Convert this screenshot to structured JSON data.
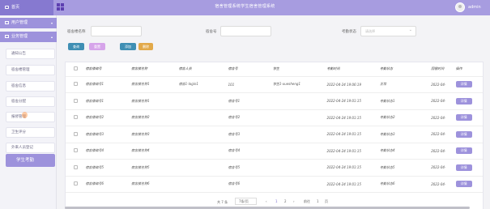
{
  "header": {
    "brand": "首页",
    "title": "宿舍管理系统学生宿舍管理系统",
    "user": "admin"
  },
  "sidebar": {
    "groups": [
      {
        "label": "用户管理"
      },
      {
        "label": "业务管理"
      }
    ],
    "items": [
      {
        "label": "通知公告"
      },
      {
        "label": "宿舍楼管理"
      },
      {
        "label": "宿舍信息"
      },
      {
        "label": "宿舍分配"
      },
      {
        "label": "报修管理"
      },
      {
        "label": "卫生评分"
      },
      {
        "label": "外来人员登记"
      },
      {
        "label": "学生考勤"
      }
    ],
    "active_index": 7
  },
  "search": {
    "building_label": "宿舍楼名称",
    "room_label": "宿舍号",
    "status_label": "考勤状态",
    "status_placeholder": "请选择"
  },
  "buttons": {
    "query": "查询",
    "reset": "重置",
    "add": "添加",
    "delete": "删除"
  },
  "table": {
    "columns": [
      "",
      "宿舍楼编号",
      "宿舍楼名称",
      "宿舍人员",
      "宿舍号",
      "学生",
      "考勤时间",
      "考勤状态",
      "回寝时间",
      "操作"
    ],
    "rows": [
      [
        "宿舍楼编号1",
        "宿舍楼名称1",
        "宿舍1-login1",
        "101",
        "学生1-xuesheng1",
        "2022-04-24 19:06:19",
        "正常",
        "2022-04-",
        "详情"
      ],
      [
        "宿舍楼编号1",
        "宿舍楼名称1",
        "",
        "宿舍号1",
        "",
        "2022-04-24 19:01:15",
        "考勤状态1",
        "2022-04-",
        "详情"
      ],
      [
        "宿舍楼编号2",
        "宿舍楼名称2",
        "",
        "宿舍号2",
        "",
        "2022-04-24 19:01:15",
        "考勤状态2",
        "2022-04-",
        "详情"
      ],
      [
        "宿舍楼编号3",
        "宿舍楼名称3",
        "",
        "宿舍号3",
        "",
        "2022-04-24 19:01:15",
        "考勤状态3",
        "2022-04-",
        "详情"
      ],
      [
        "宿舍楼编号4",
        "宿舍楼名称4",
        "",
        "宿舍号4",
        "",
        "2022-04-24 19:01:15",
        "考勤状态4",
        "2022-04-",
        "详情"
      ],
      [
        "宿舍楼编号5",
        "宿舍楼名称5",
        "",
        "宿舍号5",
        "",
        "2022-04-24 19:01:15",
        "考勤状态5",
        "2022-04-",
        "详情"
      ],
      [
        "宿舍楼编号6",
        "宿舍楼名称6",
        "",
        "宿舍号6",
        "",
        "2022-04-24 19:01:15",
        "考勤状态6",
        "2022-04-",
        "详情"
      ]
    ]
  },
  "pagination": {
    "total": "共 7 条",
    "page_size": "7条/页",
    "prev": "‹",
    "pages": [
      "1",
      "2"
    ],
    "next": "›",
    "goto": "前往",
    "goto_value": "1",
    "page_unit": "页"
  },
  "colors": {
    "accent": "#9d92dc",
    "topbar": "#a79ce0"
  }
}
